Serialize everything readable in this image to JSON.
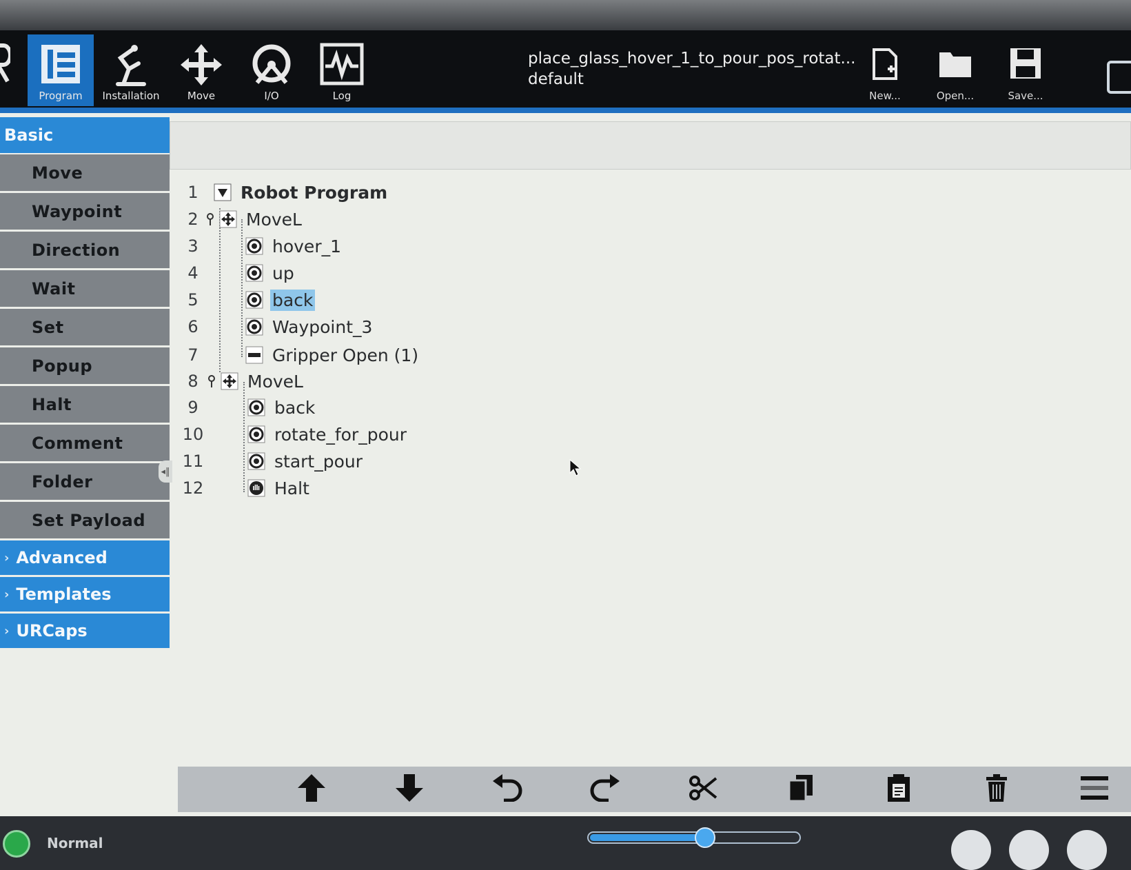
{
  "header": {
    "nav": [
      {
        "label": "Program",
        "icon": "program-icon",
        "active": true
      },
      {
        "label": "Installation",
        "icon": "installation-icon",
        "active": false
      },
      {
        "label": "Move",
        "icon": "move-icon",
        "active": false
      },
      {
        "label": "I/O",
        "icon": "io-icon",
        "active": false
      },
      {
        "label": "Log",
        "icon": "log-icon",
        "active": false
      }
    ],
    "program_name": "place_glass_hover_1_to_pour_pos_rotat...",
    "installation_name": "default",
    "file_buttons": {
      "new": "New...",
      "open": "Open...",
      "save": "Save..."
    }
  },
  "sidebar": {
    "basic_label": "Basic",
    "items": [
      "Move",
      "Waypoint",
      "Direction",
      "Wait",
      "Set",
      "Popup",
      "Halt",
      "Comment",
      "Folder",
      "Set Payload"
    ],
    "groups": [
      "Advanced",
      "Templates",
      "URCaps"
    ]
  },
  "program": {
    "lines": [
      {
        "n": "1",
        "text": "Robot Program",
        "type": "root"
      },
      {
        "n": "2",
        "text": "MoveL",
        "type": "move"
      },
      {
        "n": "3",
        "text": "hover_1",
        "type": "waypoint"
      },
      {
        "n": "4",
        "text": "up",
        "type": "waypoint"
      },
      {
        "n": "5",
        "text": "back",
        "type": "waypoint",
        "selected": true
      },
      {
        "n": "6",
        "text": "Waypoint_3",
        "type": "waypoint"
      },
      {
        "n": "7",
        "text": "Gripper Open (1)",
        "type": "gripper"
      },
      {
        "n": "8",
        "text": "MoveL",
        "type": "move"
      },
      {
        "n": "9",
        "text": "back",
        "type": "waypoint"
      },
      {
        "n": "10",
        "text": "rotate_for_pour",
        "type": "waypoint"
      },
      {
        "n": "11",
        "text": "start_pour",
        "type": "waypoint"
      },
      {
        "n": "12",
        "text": "Halt",
        "type": "halt"
      }
    ]
  },
  "edit_toolbar": [
    "move-up-icon",
    "move-down-icon",
    "undo-icon",
    "redo-icon",
    "cut-icon",
    "copy-icon",
    "paste-icon",
    "delete-icon",
    "suppress-icon"
  ],
  "footer": {
    "status": "Normal",
    "speed_fraction": 0.55
  },
  "colors": {
    "accent": "#2a89d6",
    "selection": "#8fc6ea",
    "header_bg": "#0d0f12"
  }
}
